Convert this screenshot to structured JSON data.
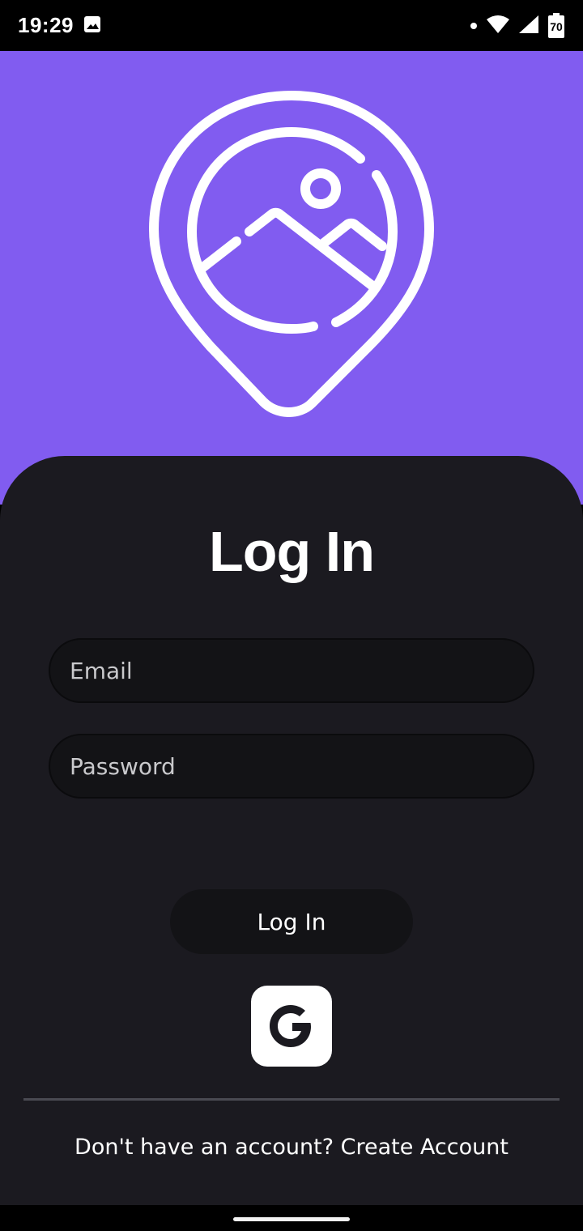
{
  "status_bar": {
    "time": "19:29",
    "battery_level": "70",
    "icons": [
      "image-icon",
      "notification-dot-icon",
      "wifi-icon",
      "signal-icon",
      "battery-icon"
    ]
  },
  "hero": {
    "background_color": "#815CF0",
    "logo_icon": "location-pin-image-icon"
  },
  "login": {
    "title": "Log In",
    "email_placeholder": "Email",
    "password_placeholder": "Password",
    "login_button_label": "Log In",
    "google_button_icon": "google-icon",
    "signup_prompt": "Don't have an account?",
    "signup_link": "Create Account"
  },
  "colors": {
    "card_background": "#1B1A20",
    "input_background": "#131316",
    "accent": "#815CF0"
  }
}
